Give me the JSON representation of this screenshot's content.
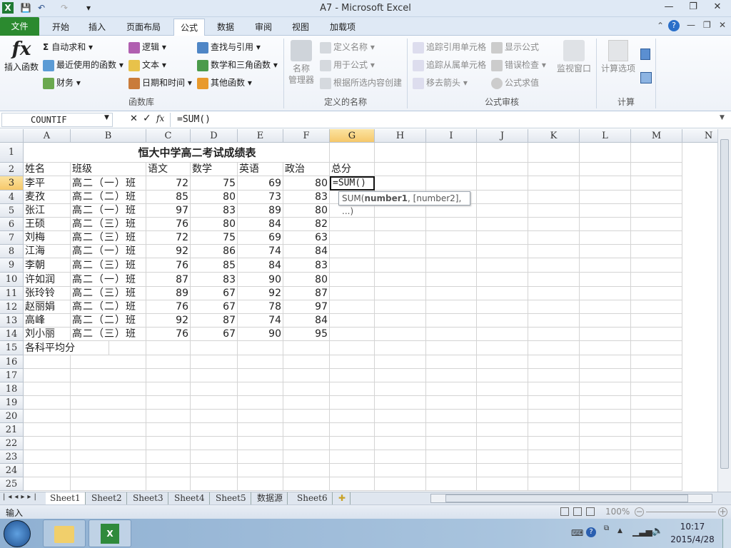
{
  "window": {
    "title": "A7  -  Microsoft Excel",
    "minimize": "—",
    "restore": "❐",
    "close": "✕"
  },
  "quick_access": {
    "save": "💾",
    "undo": "↶",
    "redo": "↷",
    "customize": "▾"
  },
  "tabs": [
    {
      "label": "文件"
    },
    {
      "label": "开始"
    },
    {
      "label": "插入"
    },
    {
      "label": "页面布局"
    },
    {
      "label": "公式",
      "active": true
    },
    {
      "label": "数据"
    },
    {
      "label": "审阅"
    },
    {
      "label": "视图"
    },
    {
      "label": "加载项"
    }
  ],
  "ribbon": {
    "insert_function": "插入函数",
    "fx": "fx",
    "library": {
      "autosum": "自动求和",
      "recent": "最近使用的函数",
      "financial": "财务",
      "logical": "逻辑",
      "text": "文本",
      "datetime": "日期和时间",
      "lookup": "查找与引用",
      "math": "数学和三角函数",
      "more": "其他函数",
      "label": "函数库"
    },
    "names": {
      "manager1": "名称",
      "manager2": "管理器",
      "define": "定义名称",
      "use": "用于公式",
      "create": "根据所选内容创建",
      "label": "定义的名称"
    },
    "audit": {
      "precedents": "追踪引用单元格",
      "dependents": "追踪从属单元格",
      "remove": "移去箭头",
      "show": "显示公式",
      "error": "错误检查",
      "evaluate": "公式求值",
      "watch": "监视窗口",
      "label": "公式审核"
    },
    "calc": {
      "options": "计算选项",
      "label": "计算"
    }
  },
  "formula_bar": {
    "name_box": "COUNTIF",
    "cancel": "✕",
    "enter": "✓",
    "fx": "fx",
    "formula": "=SUM()"
  },
  "columns": [
    "A",
    "B",
    "C",
    "D",
    "E",
    "F",
    "G",
    "H",
    "I",
    "J",
    "K",
    "L",
    "M",
    "N"
  ],
  "selected_column": "G",
  "selected_row": 3,
  "sheet": {
    "title": "恒大中学高二考试成绩表",
    "headers": [
      "姓名",
      "班级",
      "语文",
      "数学",
      "英语",
      "政治",
      "总分"
    ],
    "rows": [
      [
        "李平",
        "高二（一）班",
        72,
        75,
        69,
        80
      ],
      [
        "麦孜",
        "高二（二）班",
        85,
        80,
        73,
        83
      ],
      [
        "张江",
        "高二（一）班",
        97,
        83,
        89,
        80
      ],
      [
        "王硕",
        "高二（三）班",
        76,
        80,
        84,
        82
      ],
      [
        "刘梅",
        "高二（三）班",
        72,
        75,
        69,
        63
      ],
      [
        "江海",
        "高二（一）班",
        92,
        86,
        74,
        84
      ],
      [
        "李朝",
        "高二（三）班",
        76,
        85,
        84,
        83
      ],
      [
        "许如润",
        "高二（一）班",
        87,
        83,
        90,
        80
      ],
      [
        "张玲铃",
        "高二（三）班",
        89,
        67,
        92,
        87
      ],
      [
        "赵丽娟",
        "高二（二）班",
        76,
        67,
        78,
        97
      ],
      [
        "高峰",
        "高二（二）班",
        92,
        87,
        74,
        84
      ],
      [
        "刘小丽",
        "高二（三）班",
        76,
        67,
        90,
        95
      ]
    ],
    "footer": "各科平均分",
    "editing_cell": "=SUM()",
    "tooltip_fn": "SUM(",
    "tooltip_arg1": "number1",
    "tooltip_rest": ", [number2], ...)"
  },
  "sheet_tabs": [
    "Sheet1",
    "Sheet2",
    "Sheet3",
    "Sheet4",
    "Sheet5",
    "数据源",
    "Sheet6"
  ],
  "active_sheet": "Sheet1",
  "status": {
    "mode": "输入",
    "zoom": "100%"
  },
  "taskbar": {
    "time": "10:17",
    "date": "2015/4/28"
  }
}
